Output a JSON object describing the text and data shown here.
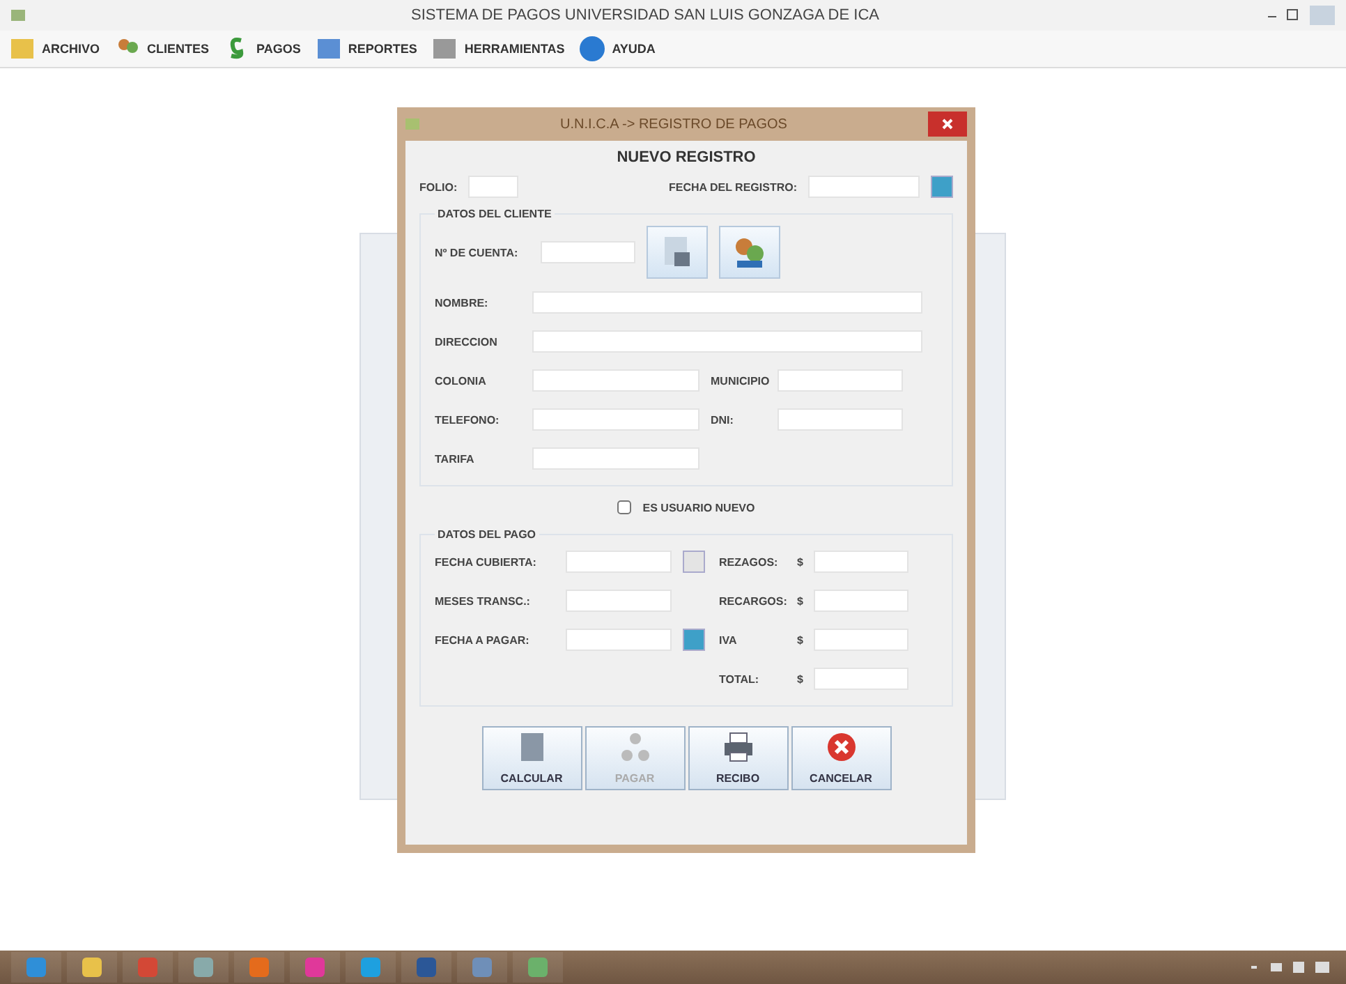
{
  "window": {
    "title": "SISTEMA DE PAGOS UNIVERSIDAD SAN LUIS GONZAGA DE ICA"
  },
  "menu": [
    {
      "label": "ARCHIVO"
    },
    {
      "label": "CLIENTES"
    },
    {
      "label": "PAGOS"
    },
    {
      "label": "REPORTES"
    },
    {
      "label": "HERRAMIENTAS"
    },
    {
      "label": "AYUDA"
    }
  ],
  "dialog": {
    "title": "U.N.I.C.A -> REGISTRO DE PAGOS",
    "heading": "NUEVO REGISTRO",
    "folio_label": "FOLIO:",
    "fecha_registro_label": "FECHA DEL REGISTRO:",
    "cliente": {
      "legend": "DATOS DEL CLIENTE",
      "cuenta_label": "Nº DE CUENTA:",
      "rows": [
        [
          {
            "label": "NOMBRE:"
          }
        ],
        [
          {
            "label": "DIRECCION"
          }
        ],
        [
          {
            "label": "COLONIA"
          },
          {
            "label": "MUNICIPIO"
          }
        ],
        [
          {
            "label": "TELEFONO:"
          },
          {
            "label": "DNI:"
          }
        ],
        [
          {
            "label": "TARIFA"
          }
        ]
      ]
    },
    "usuario_nuevo": {
      "label": "ES USUARIO NUEVO",
      "checked": false
    },
    "pago": {
      "legend": "DATOS DEL PAGO",
      "left": [
        {
          "label": "FECHA CUBIERTA:"
        },
        {
          "label": "MESES TRANSC.:"
        },
        {
          "label": "FECHA A PAGAR:"
        }
      ],
      "right": [
        {
          "label": "REZAGOS:",
          "currency": "$"
        },
        {
          "label": "RECARGOS:",
          "currency": "$"
        },
        {
          "label": "IVA",
          "currency": "$"
        },
        {
          "label": "TOTAL:",
          "currency": "$"
        }
      ]
    },
    "buttons": [
      {
        "label": "CALCULAR",
        "disabled": false
      },
      {
        "label": "PAGAR",
        "disabled": true
      },
      {
        "label": "RECIBO",
        "disabled": false
      },
      {
        "label": "CANCELAR",
        "disabled": false
      }
    ]
  }
}
